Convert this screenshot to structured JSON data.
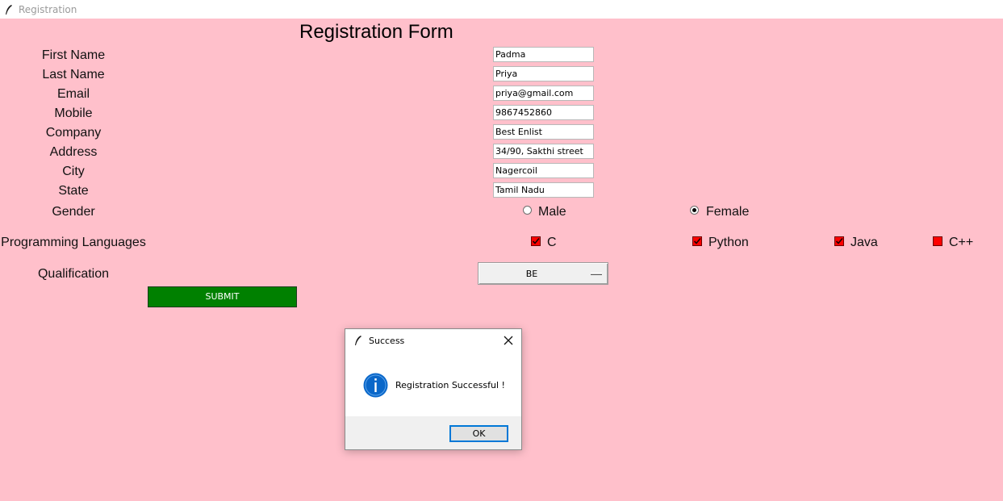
{
  "window": {
    "title": "Registration"
  },
  "form": {
    "heading": "Registration Form",
    "fields": [
      {
        "label": "First Name",
        "value": "Padma"
      },
      {
        "label": "Last Name",
        "value": "Priya"
      },
      {
        "label": "Email",
        "value": "priya@gmail.com"
      },
      {
        "label": "Mobile",
        "value": "9867452860"
      },
      {
        "label": "Company",
        "value": "Best Enlist"
      },
      {
        "label": "Address",
        "value": "34/90, Sakthi street"
      },
      {
        "label": "City",
        "value": "Nagercoil"
      },
      {
        "label": "State",
        "value": "Tamil Nadu"
      }
    ],
    "gender": {
      "label": "Gender",
      "options": [
        {
          "label": "Male",
          "checked": false
        },
        {
          "label": "Female",
          "checked": true
        }
      ]
    },
    "languages": {
      "label": "Programming Languages",
      "options": [
        {
          "label": "C",
          "checked": true
        },
        {
          "label": "Python",
          "checked": true
        },
        {
          "label": "Java",
          "checked": true
        },
        {
          "label": "C++",
          "checked": false
        }
      ]
    },
    "qualification": {
      "label": "Qualification",
      "value": "BE"
    },
    "submit_label": "SUBMIT"
  },
  "dialog": {
    "title": "Success",
    "message": "Registration Successful !",
    "ok_label": "OK"
  },
  "colors": {
    "background": "#ffc0cb",
    "submit": "#008000",
    "checkbox": "#ff0000",
    "info_icon": "#0a67c9"
  }
}
